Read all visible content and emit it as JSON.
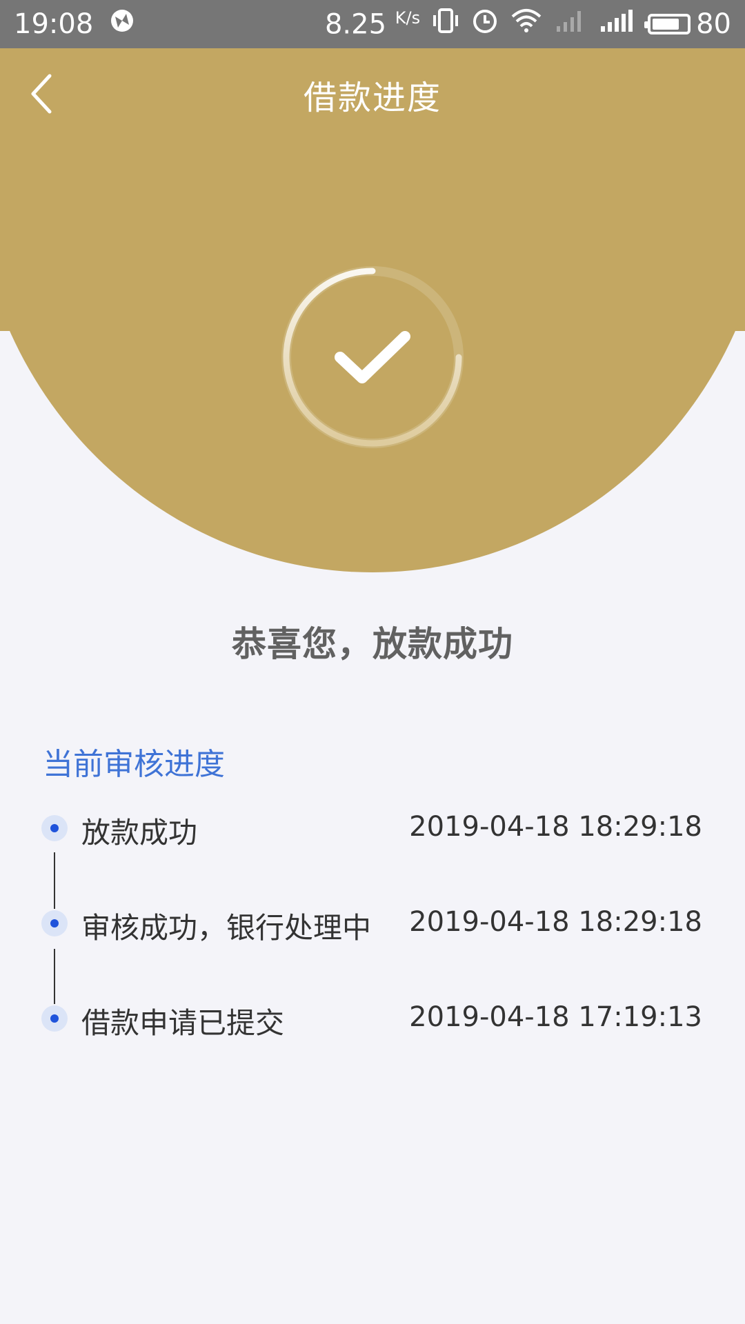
{
  "status_bar": {
    "time": "19:08",
    "speed_value": "8.25",
    "speed_unit": "K/s",
    "battery": "80"
  },
  "header": {
    "title": "借款进度"
  },
  "result": {
    "message": "恭喜您，放款成功"
  },
  "progress": {
    "section_title": "当前审核进度",
    "steps": [
      {
        "label": "放款成功",
        "time": "2019-04-18 18:29:18"
      },
      {
        "label": "审核成功，银行处理中",
        "time": "2019-04-18 18:29:18"
      },
      {
        "label": "借款申请已提交",
        "time": "2019-04-18 17:19:13"
      }
    ]
  },
  "colors": {
    "gold": "#c3a762",
    "accent_blue": "#3f73d6",
    "dot_blue": "#1f53db"
  }
}
